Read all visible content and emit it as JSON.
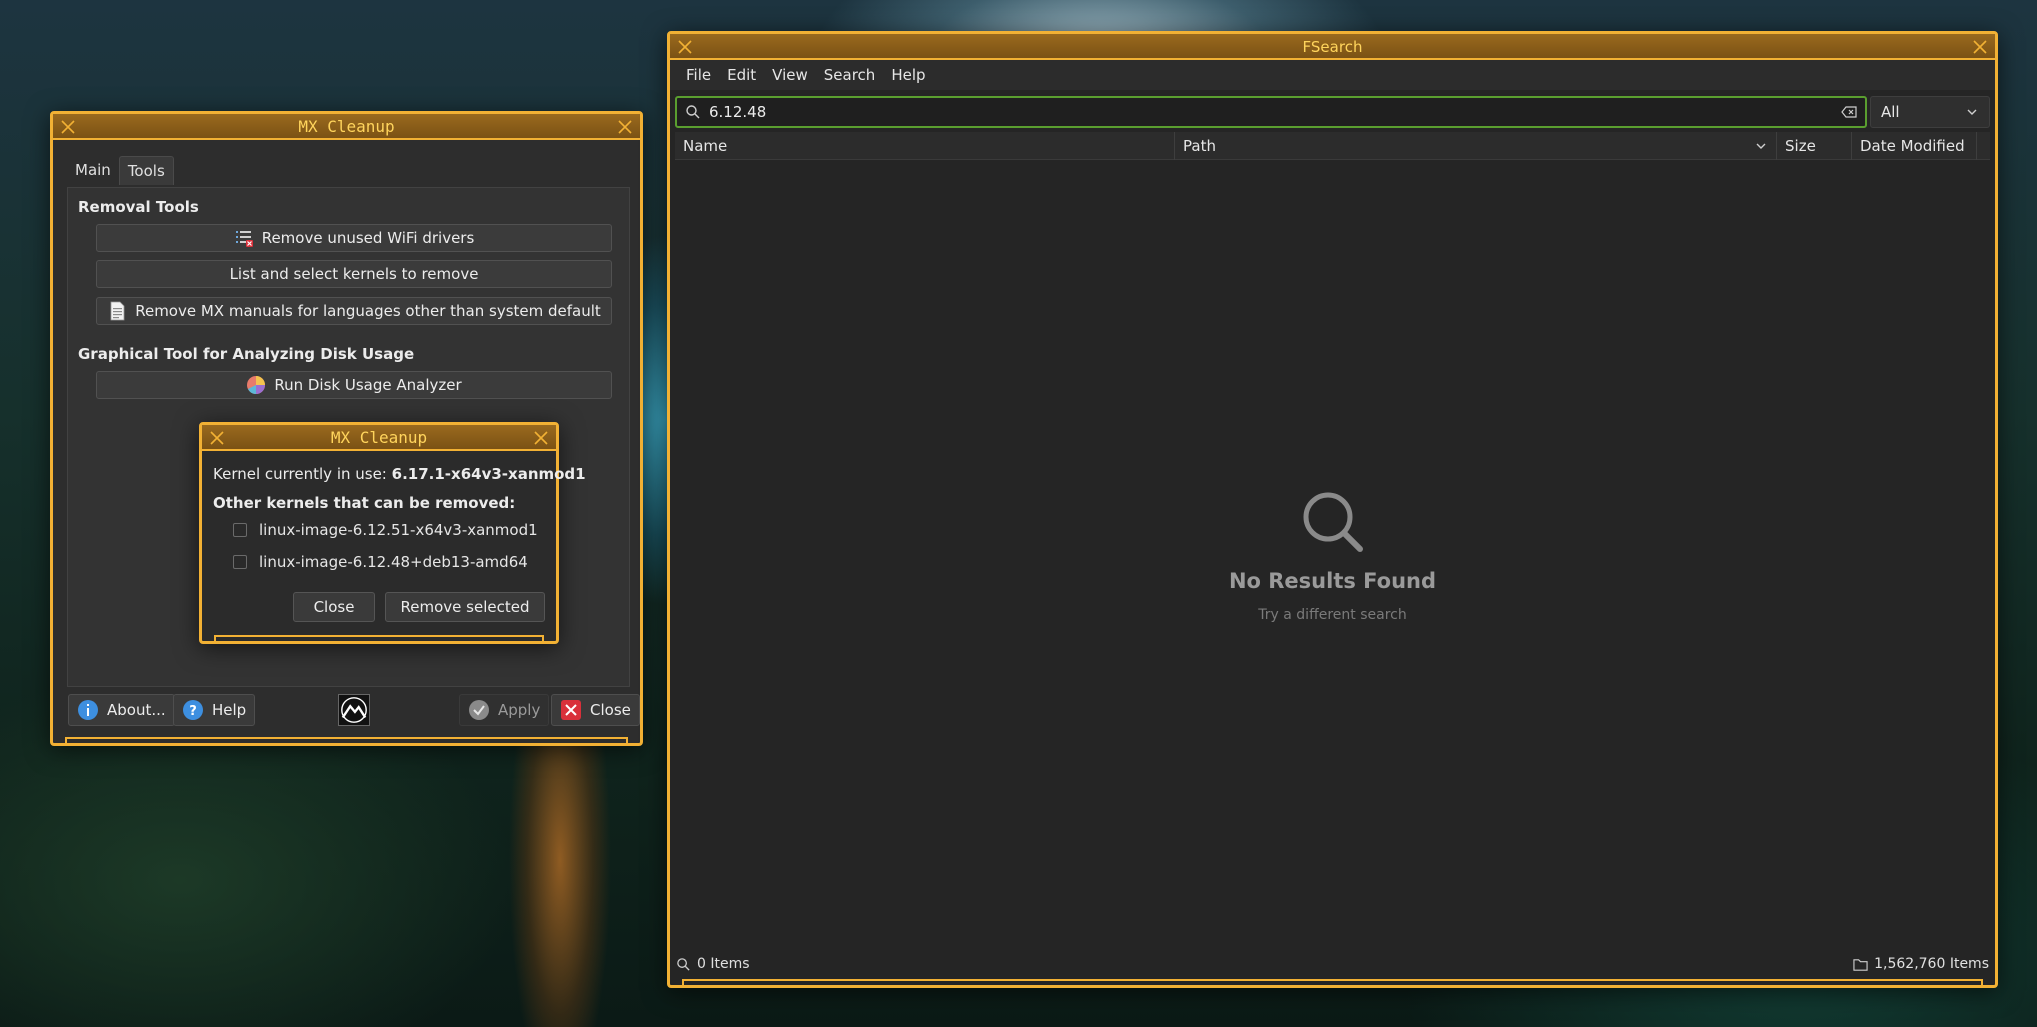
{
  "mx_cleanup": {
    "title": "MX Cleanup",
    "tabs": [
      "Main",
      "Tools"
    ],
    "active_tab": "Tools",
    "removal_tools_title": "Removal Tools",
    "wifi_button": "Remove unused WiFi drivers",
    "kernels_button": "List and select kernels to remove",
    "manuals_button": "Remove MX manuals for languages other than system default",
    "disk_usage_title": "Graphical Tool for Analyzing Disk Usage",
    "disk_usage_button": "Run Disk Usage Analyzer",
    "footer": {
      "about": "About...",
      "help": "Help",
      "apply": "Apply",
      "close": "Close"
    }
  },
  "kernel_dialog": {
    "title": "MX Cleanup",
    "kernel_in_use_label": "Kernel currently in use:",
    "kernel_in_use_value": "6.17.1-x64v3-xanmod1",
    "other_label": "Other kernels that can be removed:",
    "kernels": [
      "linux-image-6.12.51-x64v3-xanmod1",
      "linux-image-6.12.48+deb13-amd64"
    ],
    "close": "Close",
    "remove_selected": "Remove selected"
  },
  "fsearch": {
    "title": "FSearch",
    "menu": [
      "File",
      "Edit",
      "View",
      "Search",
      "Help"
    ],
    "search_value": "6.12.48",
    "filter": "All",
    "columns": [
      "Name",
      "Path",
      "Size",
      "Date Modified"
    ],
    "empty_title": "No Results Found",
    "empty_sub": "Try a different search",
    "status_left": "0 Items",
    "status_right": "1,562,760 Items"
  },
  "colors": {
    "border": "#f2b134",
    "title_text": "#ffd45c",
    "search_focus": "#5a9e2f"
  }
}
